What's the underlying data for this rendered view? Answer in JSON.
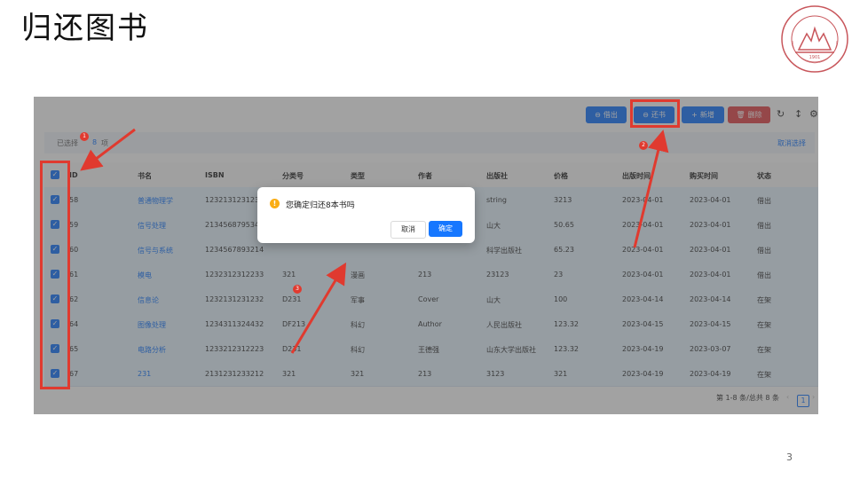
{
  "slide": {
    "title": "归还图书",
    "page_number": "3",
    "logo_text": "SHANDONG UNIVERSITY",
    "logo_year": "1901"
  },
  "toolbar": {
    "borrow": "借出",
    "return": "还书",
    "add": "新增",
    "delete": "删除",
    "colors": {
      "primary": "#1677ff",
      "danger": "#e5484d"
    }
  },
  "selection": {
    "prefix": "已选择",
    "count": "8",
    "suffix": "项",
    "clear": "取消选择"
  },
  "table": {
    "columns": [
      "ID",
      "书名",
      "ISBN",
      "分类号",
      "类型",
      "作者",
      "出版社",
      "价格",
      "出版时间",
      "购买时间",
      "状态"
    ],
    "rows": [
      [
        "58",
        "普通物理学",
        "1232131231233",
        "",
        "",
        "",
        "string",
        "3213",
        "2023-04-01",
        "2023-04-01",
        "借出"
      ],
      [
        "59",
        "信号处理",
        "2134568795346",
        "",
        "",
        "",
        "山大",
        "50.65",
        "2023-04-01",
        "2023-04-01",
        "借出"
      ],
      [
        "60",
        "信号与系统",
        "1234567893214",
        "",
        "",
        "",
        "科学出版社",
        "65.23",
        "2023-04-01",
        "2023-04-01",
        "借出"
      ],
      [
        "61",
        "模电",
        "1232312312233",
        "321",
        "漫画",
        "213",
        "23123",
        "23",
        "2023-04-01",
        "2023-04-01",
        "借出"
      ],
      [
        "62",
        "信息论",
        "1232131231232",
        "D231",
        "军事",
        "Cover",
        "山大",
        "100",
        "2023-04-14",
        "2023-04-14",
        "在架"
      ],
      [
        "64",
        "图像处理",
        "1234311324432",
        "DF213",
        "科幻",
        "Author",
        "人民出版社",
        "123.32",
        "2023-04-15",
        "2023-04-15",
        "在架"
      ],
      [
        "65",
        "电路分析",
        "1233212312223",
        "D231",
        "科幻",
        "王德强",
        "山东大学出版社",
        "123.32",
        "2023-04-19",
        "2023-03-07",
        "在架"
      ],
      [
        "67",
        "231",
        "2131231233212",
        "321",
        "321",
        "213",
        "3123",
        "321",
        "2023-04-19",
        "2023-04-19",
        "在架"
      ]
    ]
  },
  "pagination": {
    "summary": "第 1-8 条/总共 8 条",
    "current_page": "1"
  },
  "dialog": {
    "message": "您确定归还8本书吗",
    "cancel": "取消",
    "confirm": "确定"
  },
  "annotations": {
    "steps": [
      "1",
      "2",
      "3"
    ],
    "color": "#e03a2f"
  }
}
